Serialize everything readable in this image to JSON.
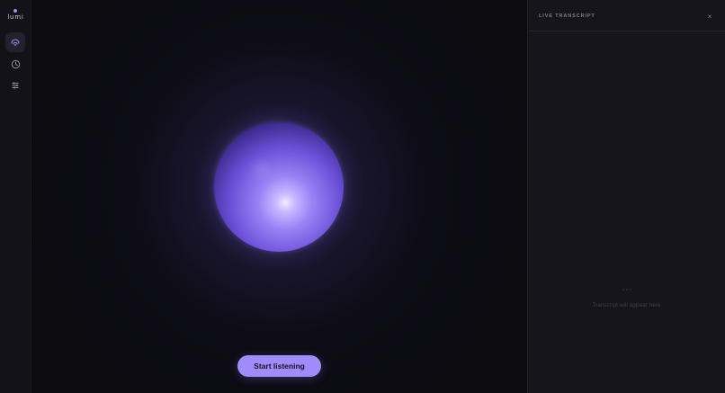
{
  "brand": {
    "name": "lumi"
  },
  "sidebar": {
    "items": [
      {
        "icon": "signal-icon",
        "active": true
      },
      {
        "icon": "clock-icon",
        "active": false
      },
      {
        "icon": "sliders-icon",
        "active": false
      }
    ]
  },
  "stage": {
    "start_label": "Start listening"
  },
  "transcript": {
    "title": "LIVE TRANSCRIPT",
    "close_glyph": "×",
    "empty_icon": "ellipsis-icon",
    "empty_text": "Transcript will appear here"
  },
  "colors": {
    "accent": "#a08cf8",
    "background": "#0b0b10",
    "panel": "#15151b",
    "sidebar": "#121218"
  }
}
